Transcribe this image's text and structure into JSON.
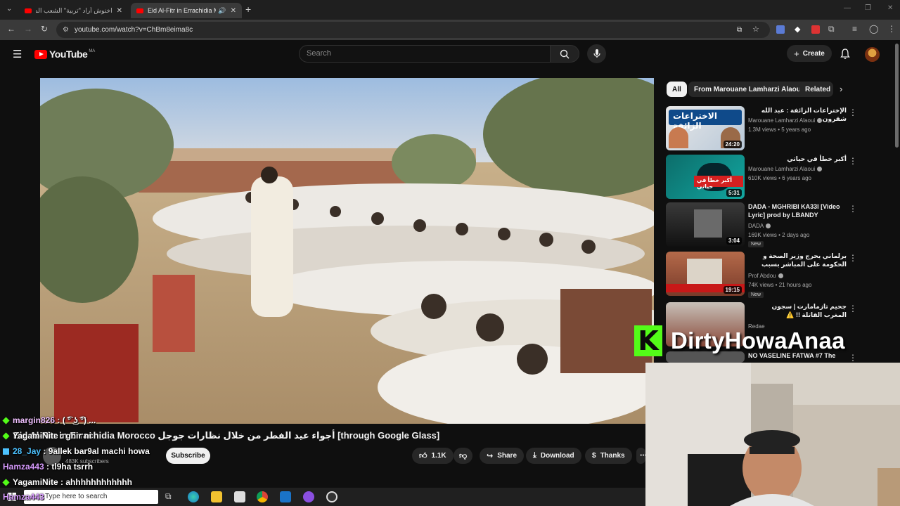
{
  "browser": {
    "tabs": [
      {
        "title": "اخنوش أراد \"تربية\" الشعب المغر...",
        "active": false
      },
      {
        "title": "Eid Al-Fitr in Errachidia Mo...",
        "active": true
      }
    ],
    "url": "youtube.com/watch?v=ChBm8eima8c"
  },
  "youtube": {
    "logo_text": "YouTube",
    "logo_region": "MA",
    "search_placeholder": "Search",
    "create_label": "Create"
  },
  "chips": [
    "All",
    "From Marouane Lamharzi Alaoui",
    "Related"
  ],
  "recommendations": [
    {
      "title": "الإختراعات الزائفة : عبد الله شقرون",
      "channel": "Marouane Lamharzi Alaoui",
      "verified": true,
      "meta": "1.3M views • 5 years ago",
      "duration": "24:20",
      "badge": "",
      "thumb_text": "الاختراعات الزائفة"
    },
    {
      "title": "أكبر خطأ في حياتي",
      "channel": "Marouane Lamharzi Alaoui",
      "verified": true,
      "meta": "610K views • 6 years ago",
      "duration": "5:31",
      "badge": "",
      "thumb_text": "أكبر خطأ في حياتي"
    },
    {
      "title": "DADA - MGHRIBI KA33I [Video Lyric] prod by LBANDY",
      "channel": "DADA",
      "verified": true,
      "meta": "169K views • 2 days ago",
      "duration": "3:04",
      "badge": "New",
      "thumb_text": ""
    },
    {
      "title": "برلماني يحرج وزير الصحة و الحكومة على المباشر بسبب احتجاجات الشباب، حكومة ...",
      "channel": "Prof Abdou",
      "verified": true,
      "meta": "74K views • 21 hours ago",
      "duration": "19:15",
      "badge": "New",
      "thumb_text": ""
    },
    {
      "title": "جحيم تازمامارت | سجون المغرب القاتلة !! ⚠️",
      "channel": "Redae",
      "verified": false,
      "meta": "",
      "duration": "",
      "badge": "",
      "thumb_text": ""
    },
    {
      "title": "NO VASELINE FATWA #7 The",
      "channel": "",
      "verified": false,
      "meta": "",
      "duration": "",
      "badge": "",
      "thumb_text": ""
    }
  ],
  "video": {
    "title": "Eid Al-Fitr in Errachidia Morocco أجواء عيد الفطر من خلال نظارات جوجل [through Google Glass]",
    "subscribers": "483K subscribers",
    "subscribe_label": "Subscribe",
    "likes": "1.1K",
    "share_label": "Share",
    "download_label": "Download",
    "thanks_label": "Thanks"
  },
  "chat": [
    {
      "user": "margin826",
      "message": "( ͡° ͜ʖ ͡°) ...",
      "user_color": "#f0c0ff",
      "icon": "diamond"
    },
    {
      "user": "YagamiNite",
      "message": "ghir ni",
      "user_color": "#ffffff",
      "icon": "diamond"
    },
    {
      "user": "28_Jay",
      "message": "9allek bar9al machi howa",
      "user_color": "#4cc2ff",
      "icon": "badge"
    },
    {
      "user": "Hamza443",
      "message": "tl9ha tsrrh",
      "user_color": "#d99cff",
      "icon": ""
    },
    {
      "user": "YagamiNite",
      "message": "ahhhhhhhhhhhh",
      "user_color": "#ffffff",
      "icon": "diamond"
    },
    {
      "user": "Hamza443",
      "message": "",
      "user_color": "#d99cff",
      "icon": ""
    }
  ],
  "overlay": {
    "streamer_name": "DirtyHowaAnaa",
    "platform_logo": "K",
    "accent": "#53fc18"
  },
  "taskbar": {
    "search_placeholder": "Type here to search"
  }
}
